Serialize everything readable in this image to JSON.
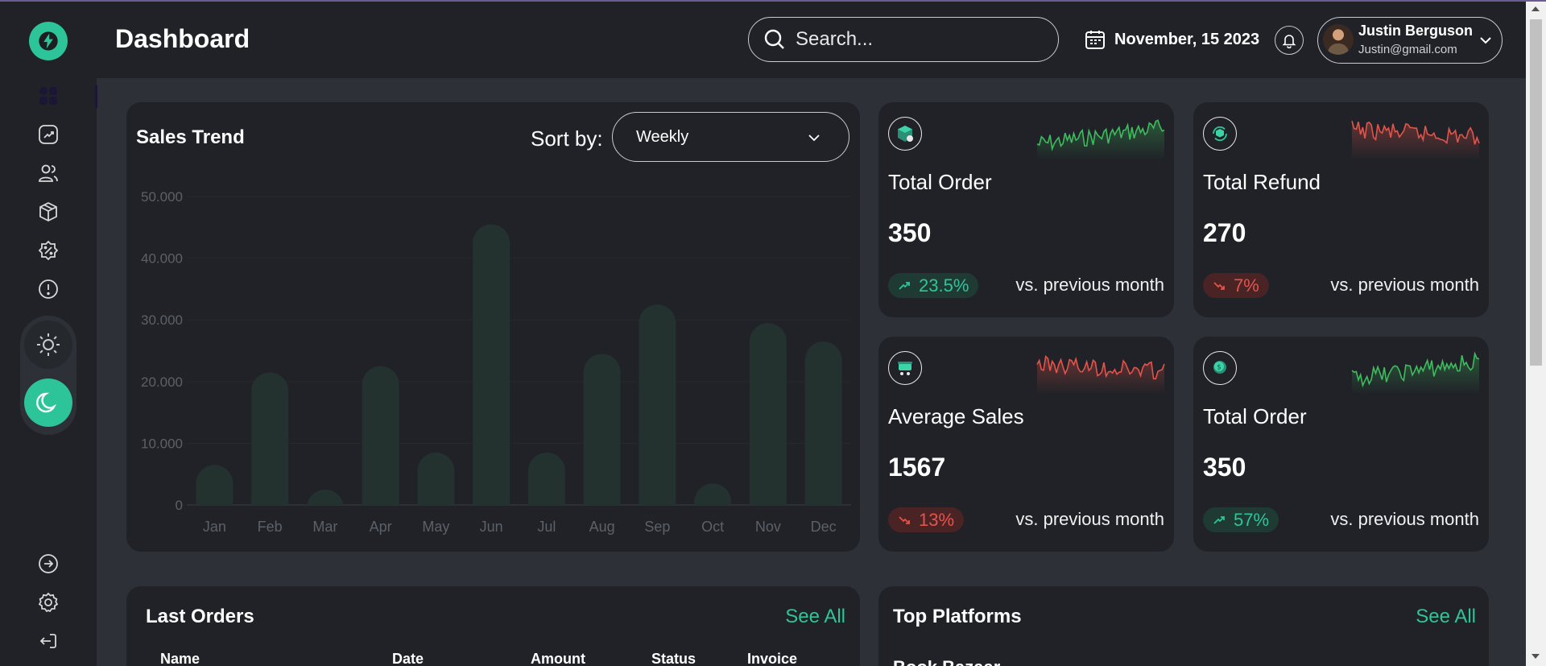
{
  "header": {
    "title": "Dashboard",
    "search_placeholder": "Search...",
    "date": "November, 15 2023",
    "user_name": "Justin Berguson",
    "user_email": "Justin@gmail.com"
  },
  "sidebar": {
    "items": [
      "dashboard",
      "analytics",
      "users",
      "products",
      "discounts",
      "alerts"
    ],
    "bottom_items": [
      "login",
      "settings",
      "logout"
    ]
  },
  "sales_trend": {
    "title": "Sales Trend",
    "sort_label": "Sort by:",
    "sort_value": "Weekly"
  },
  "chart_data": {
    "type": "bar",
    "categories": [
      "Jan",
      "Feb",
      "Mar",
      "Apr",
      "May",
      "Jun",
      "Jul",
      "Aug",
      "Sep",
      "Oct",
      "Nov",
      "Dec"
    ],
    "values": [
      6500,
      21500,
      2500,
      22500,
      8500,
      45500,
      8500,
      24500,
      32500,
      3500,
      29500,
      26500
    ],
    "y_ticks": [
      "0",
      "10.000",
      "20.000",
      "30.000",
      "40.000",
      "50.000"
    ],
    "ylim": [
      0,
      50000
    ],
    "bar_color": "#23312f",
    "grid": true
  },
  "stats": [
    {
      "label": "Total Order",
      "value": "350",
      "change": "23.5%",
      "direction": "up",
      "compare": "vs. previous month",
      "icon": "box-icon",
      "spark_color": "#3dbd5d"
    },
    {
      "label": "Total Refund",
      "value": "270",
      "change": "7%",
      "direction": "down",
      "compare": "vs. previous month",
      "icon": "refund-box-icon",
      "spark_color": "#e5534b"
    },
    {
      "label": "Average Sales",
      "value": "1567",
      "change": "13%",
      "direction": "down",
      "compare": "vs. previous month",
      "icon": "cart-icon",
      "spark_color": "#e5534b"
    },
    {
      "label": "Total Order",
      "value": "350",
      "change": "57%",
      "direction": "up",
      "compare": "vs. previous month",
      "icon": "coin-icon",
      "spark_color": "#3dbd5d"
    }
  ],
  "last_orders": {
    "title": "Last Orders",
    "see_all": "See All",
    "columns": [
      "Name",
      "Date",
      "Amount",
      "Status",
      "Invoice"
    ]
  },
  "top_platforms": {
    "title": "Top Platforms",
    "see_all": "See All",
    "first_item": "Book Bazaar"
  },
  "colors": {
    "accent": "#2ec49a",
    "negative": "#e5534b",
    "card_bg": "#202227",
    "page_bg": "#2d3036"
  }
}
